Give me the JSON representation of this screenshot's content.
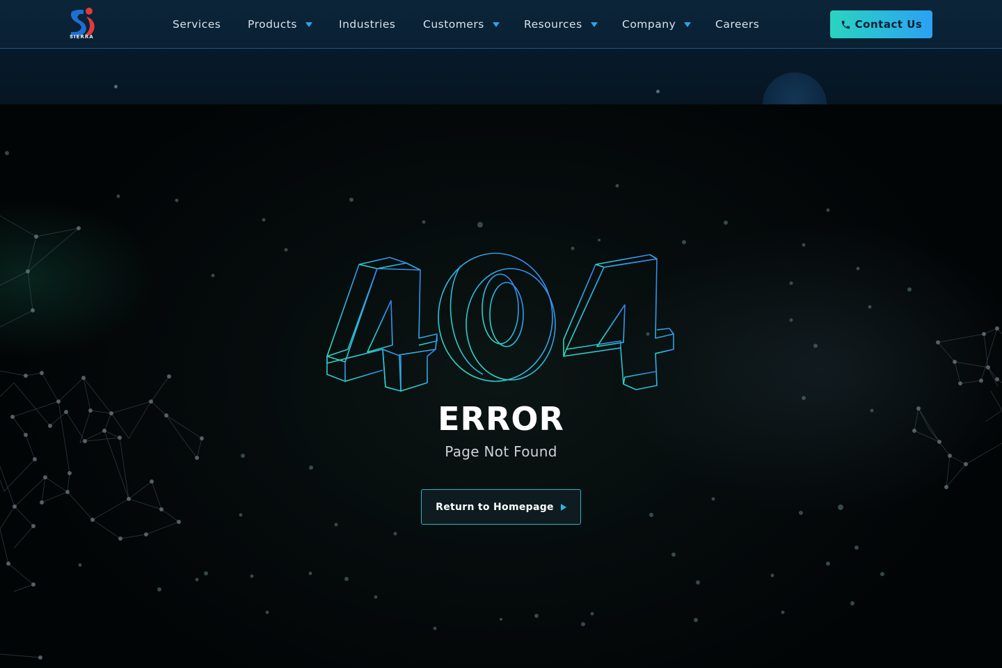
{
  "brand": {
    "name": "SIERRA",
    "logo_icon": "sierra-logo",
    "colors": {
      "blue": "#1f6fd1",
      "red": "#e23a3a"
    }
  },
  "nav": {
    "items": [
      {
        "label": "Services",
        "has_dropdown": false
      },
      {
        "label": "Products",
        "has_dropdown": true
      },
      {
        "label": "Industries",
        "has_dropdown": false
      },
      {
        "label": "Customers",
        "has_dropdown": true
      },
      {
        "label": "Resources",
        "has_dropdown": true
      },
      {
        "label": "Company",
        "has_dropdown": true
      },
      {
        "label": "Careers",
        "has_dropdown": false
      }
    ],
    "contact": {
      "label": "Contact Us",
      "icon": "phone-icon"
    }
  },
  "error": {
    "code": "404",
    "title": "ERROR",
    "subtitle": "Page Not Found",
    "button_label": "Return to Homepage",
    "button_icon": "play-arrow-icon"
  },
  "theme": {
    "accent_start": "#2ad4c0",
    "accent_end": "#2ba1f3",
    "background": "#020608",
    "header_bg": "#0b2438"
  }
}
